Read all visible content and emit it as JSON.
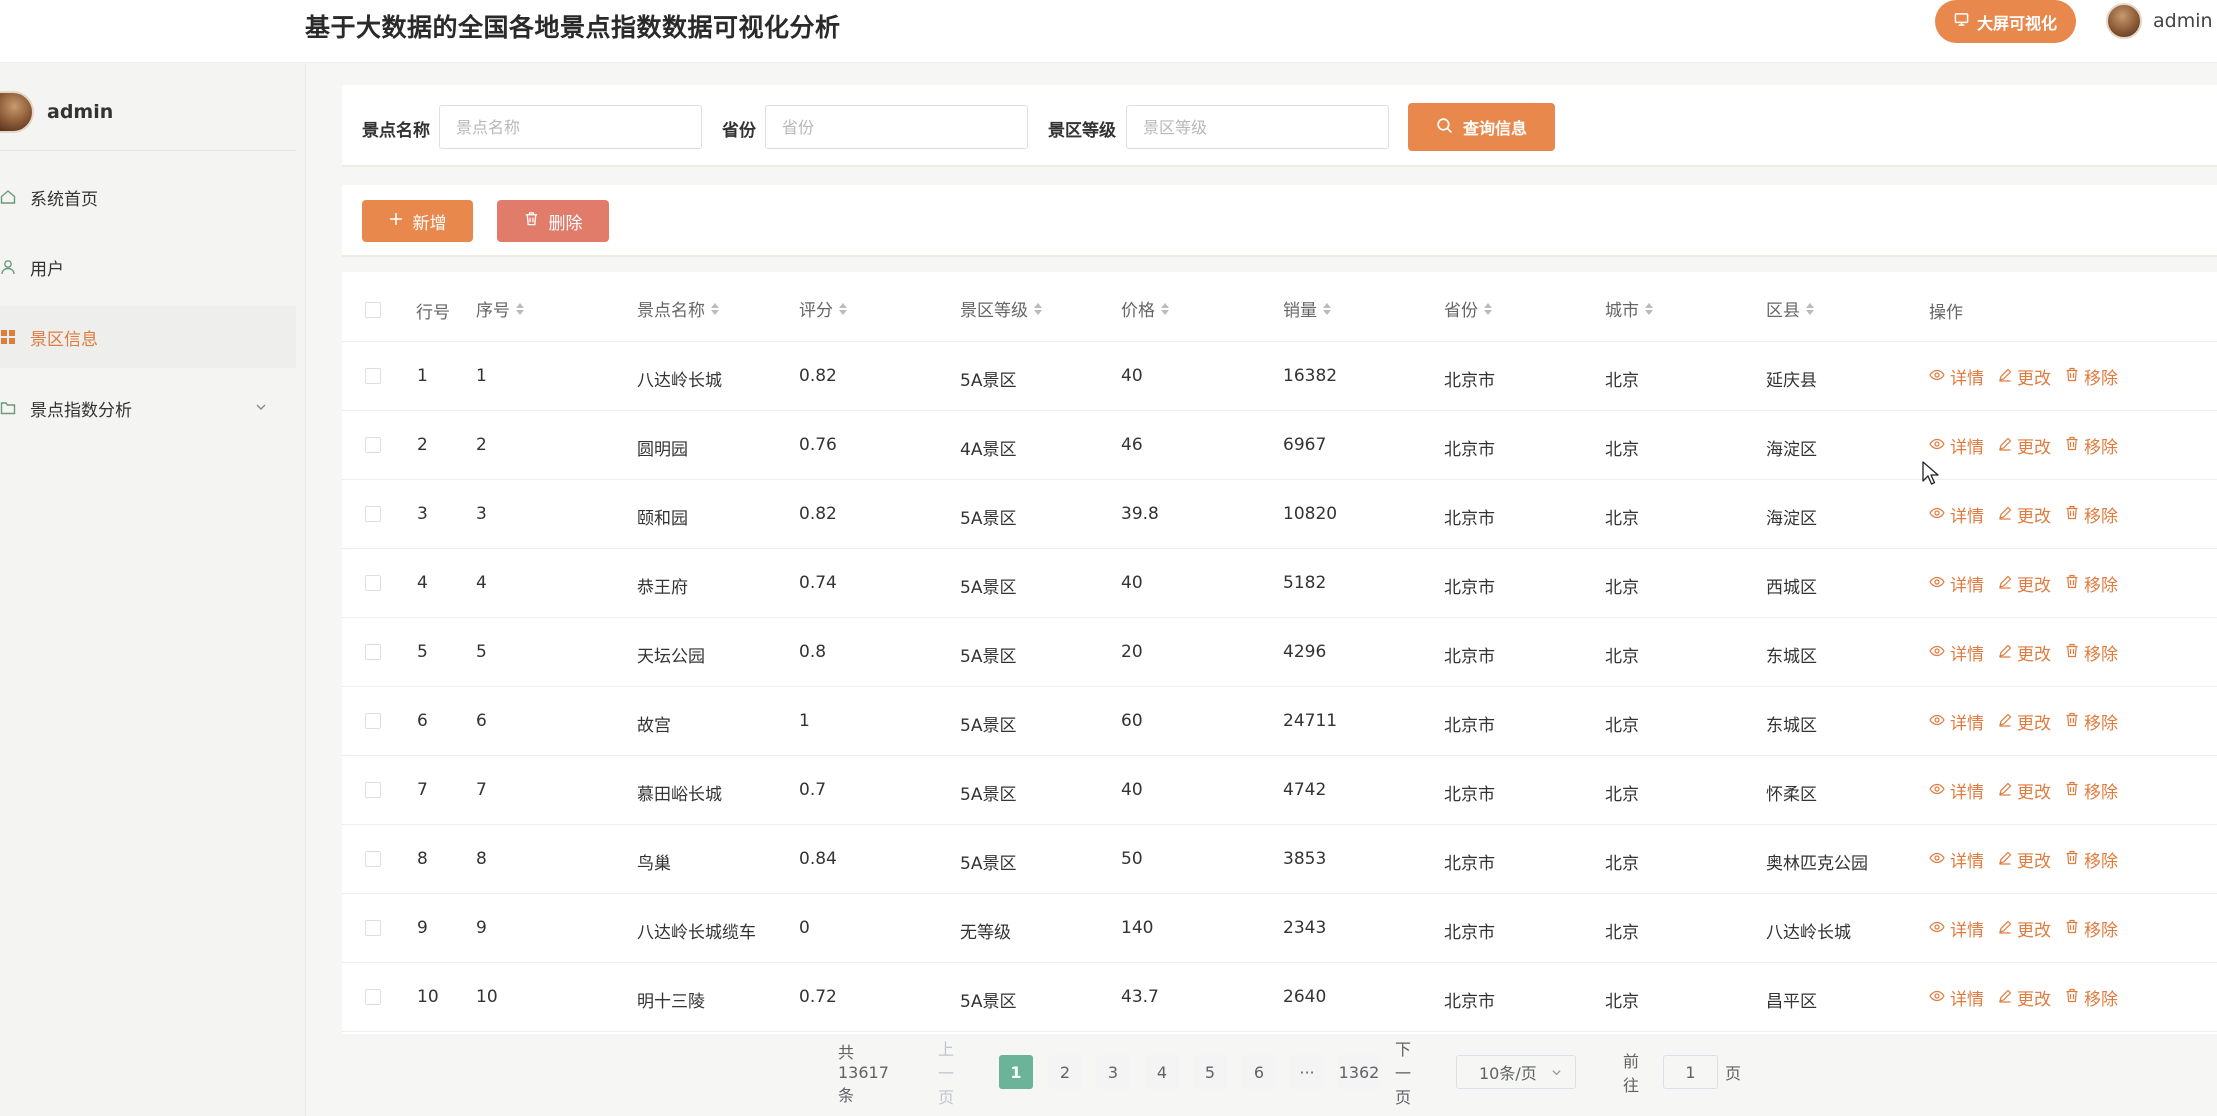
{
  "header": {
    "title": "基于大数据的全国各地景点指数数据可视化分析",
    "bigscreen_label": "大屏可视化",
    "user": "admin"
  },
  "sidebar": {
    "user": "admin",
    "items": [
      {
        "label": "系统首页",
        "icon": "home-icon"
      },
      {
        "label": "用户",
        "icon": "user-icon"
      },
      {
        "label": "景区信息",
        "icon": "grid-icon",
        "active": true
      },
      {
        "label": "景点指数分析",
        "icon": "folder-icon",
        "expandable": true
      }
    ]
  },
  "search": {
    "name_label": "景点名称",
    "name_placeholder": "景点名称",
    "province_label": "省份",
    "province_placeholder": "省份",
    "level_label": "景区等级",
    "level_placeholder": "景区等级",
    "query_label": "查询信息"
  },
  "actions": {
    "add_label": "新增",
    "delete_label": "删除"
  },
  "table": {
    "columns": [
      "行号",
      "序号",
      "景点名称",
      "评分",
      "景区等级",
      "价格",
      "销量",
      "省份",
      "城市",
      "区县",
      "操作"
    ],
    "op_labels": {
      "detail": "详情",
      "edit": "更改",
      "remove": "移除"
    },
    "rows": [
      [
        "1",
        "1",
        "八达岭长城",
        "0.82",
        "5A景区",
        "40",
        "16382",
        "北京市",
        "北京",
        "延庆县"
      ],
      [
        "2",
        "2",
        "圆明园",
        "0.76",
        "4A景区",
        "46",
        "6967",
        "北京市",
        "北京",
        "海淀区"
      ],
      [
        "3",
        "3",
        "颐和园",
        "0.82",
        "5A景区",
        "39.8",
        "10820",
        "北京市",
        "北京",
        "海淀区"
      ],
      [
        "4",
        "4",
        "恭王府",
        "0.74",
        "5A景区",
        "40",
        "5182",
        "北京市",
        "北京",
        "西城区"
      ],
      [
        "5",
        "5",
        "天坛公园",
        "0.8",
        "5A景区",
        "20",
        "4296",
        "北京市",
        "北京",
        "东城区"
      ],
      [
        "6",
        "6",
        "故宫",
        "1",
        "5A景区",
        "60",
        "24711",
        "北京市",
        "北京",
        "东城区"
      ],
      [
        "7",
        "7",
        "慕田峪长城",
        "0.7",
        "5A景区",
        "40",
        "4742",
        "北京市",
        "北京",
        "怀柔区"
      ],
      [
        "8",
        "8",
        "鸟巢",
        "0.84",
        "5A景区",
        "50",
        "3853",
        "北京市",
        "北京",
        "奥林匹克公园"
      ],
      [
        "9",
        "9",
        "八达岭长城缆车",
        "0",
        "无等级",
        "140",
        "2343",
        "北京市",
        "北京",
        "八达岭长城"
      ],
      [
        "10",
        "10",
        "明十三陵",
        "0.72",
        "5A景区",
        "43.7",
        "2640",
        "北京市",
        "北京",
        "昌平区"
      ]
    ]
  },
  "pagination": {
    "total": "共 13617 条",
    "prev": "上一页",
    "pages": [
      "1",
      "2",
      "3",
      "4",
      "5",
      "6"
    ],
    "ellipsis": "···",
    "last": "1362",
    "next": "下一页",
    "page_size": "10条/页",
    "goto_label": "前往",
    "goto_value": "1",
    "page_unit": "页",
    "current": 1
  },
  "colors": {
    "accent": "#e8884d",
    "danger": "#e27c6a",
    "active_page": "#6bb49a"
  }
}
